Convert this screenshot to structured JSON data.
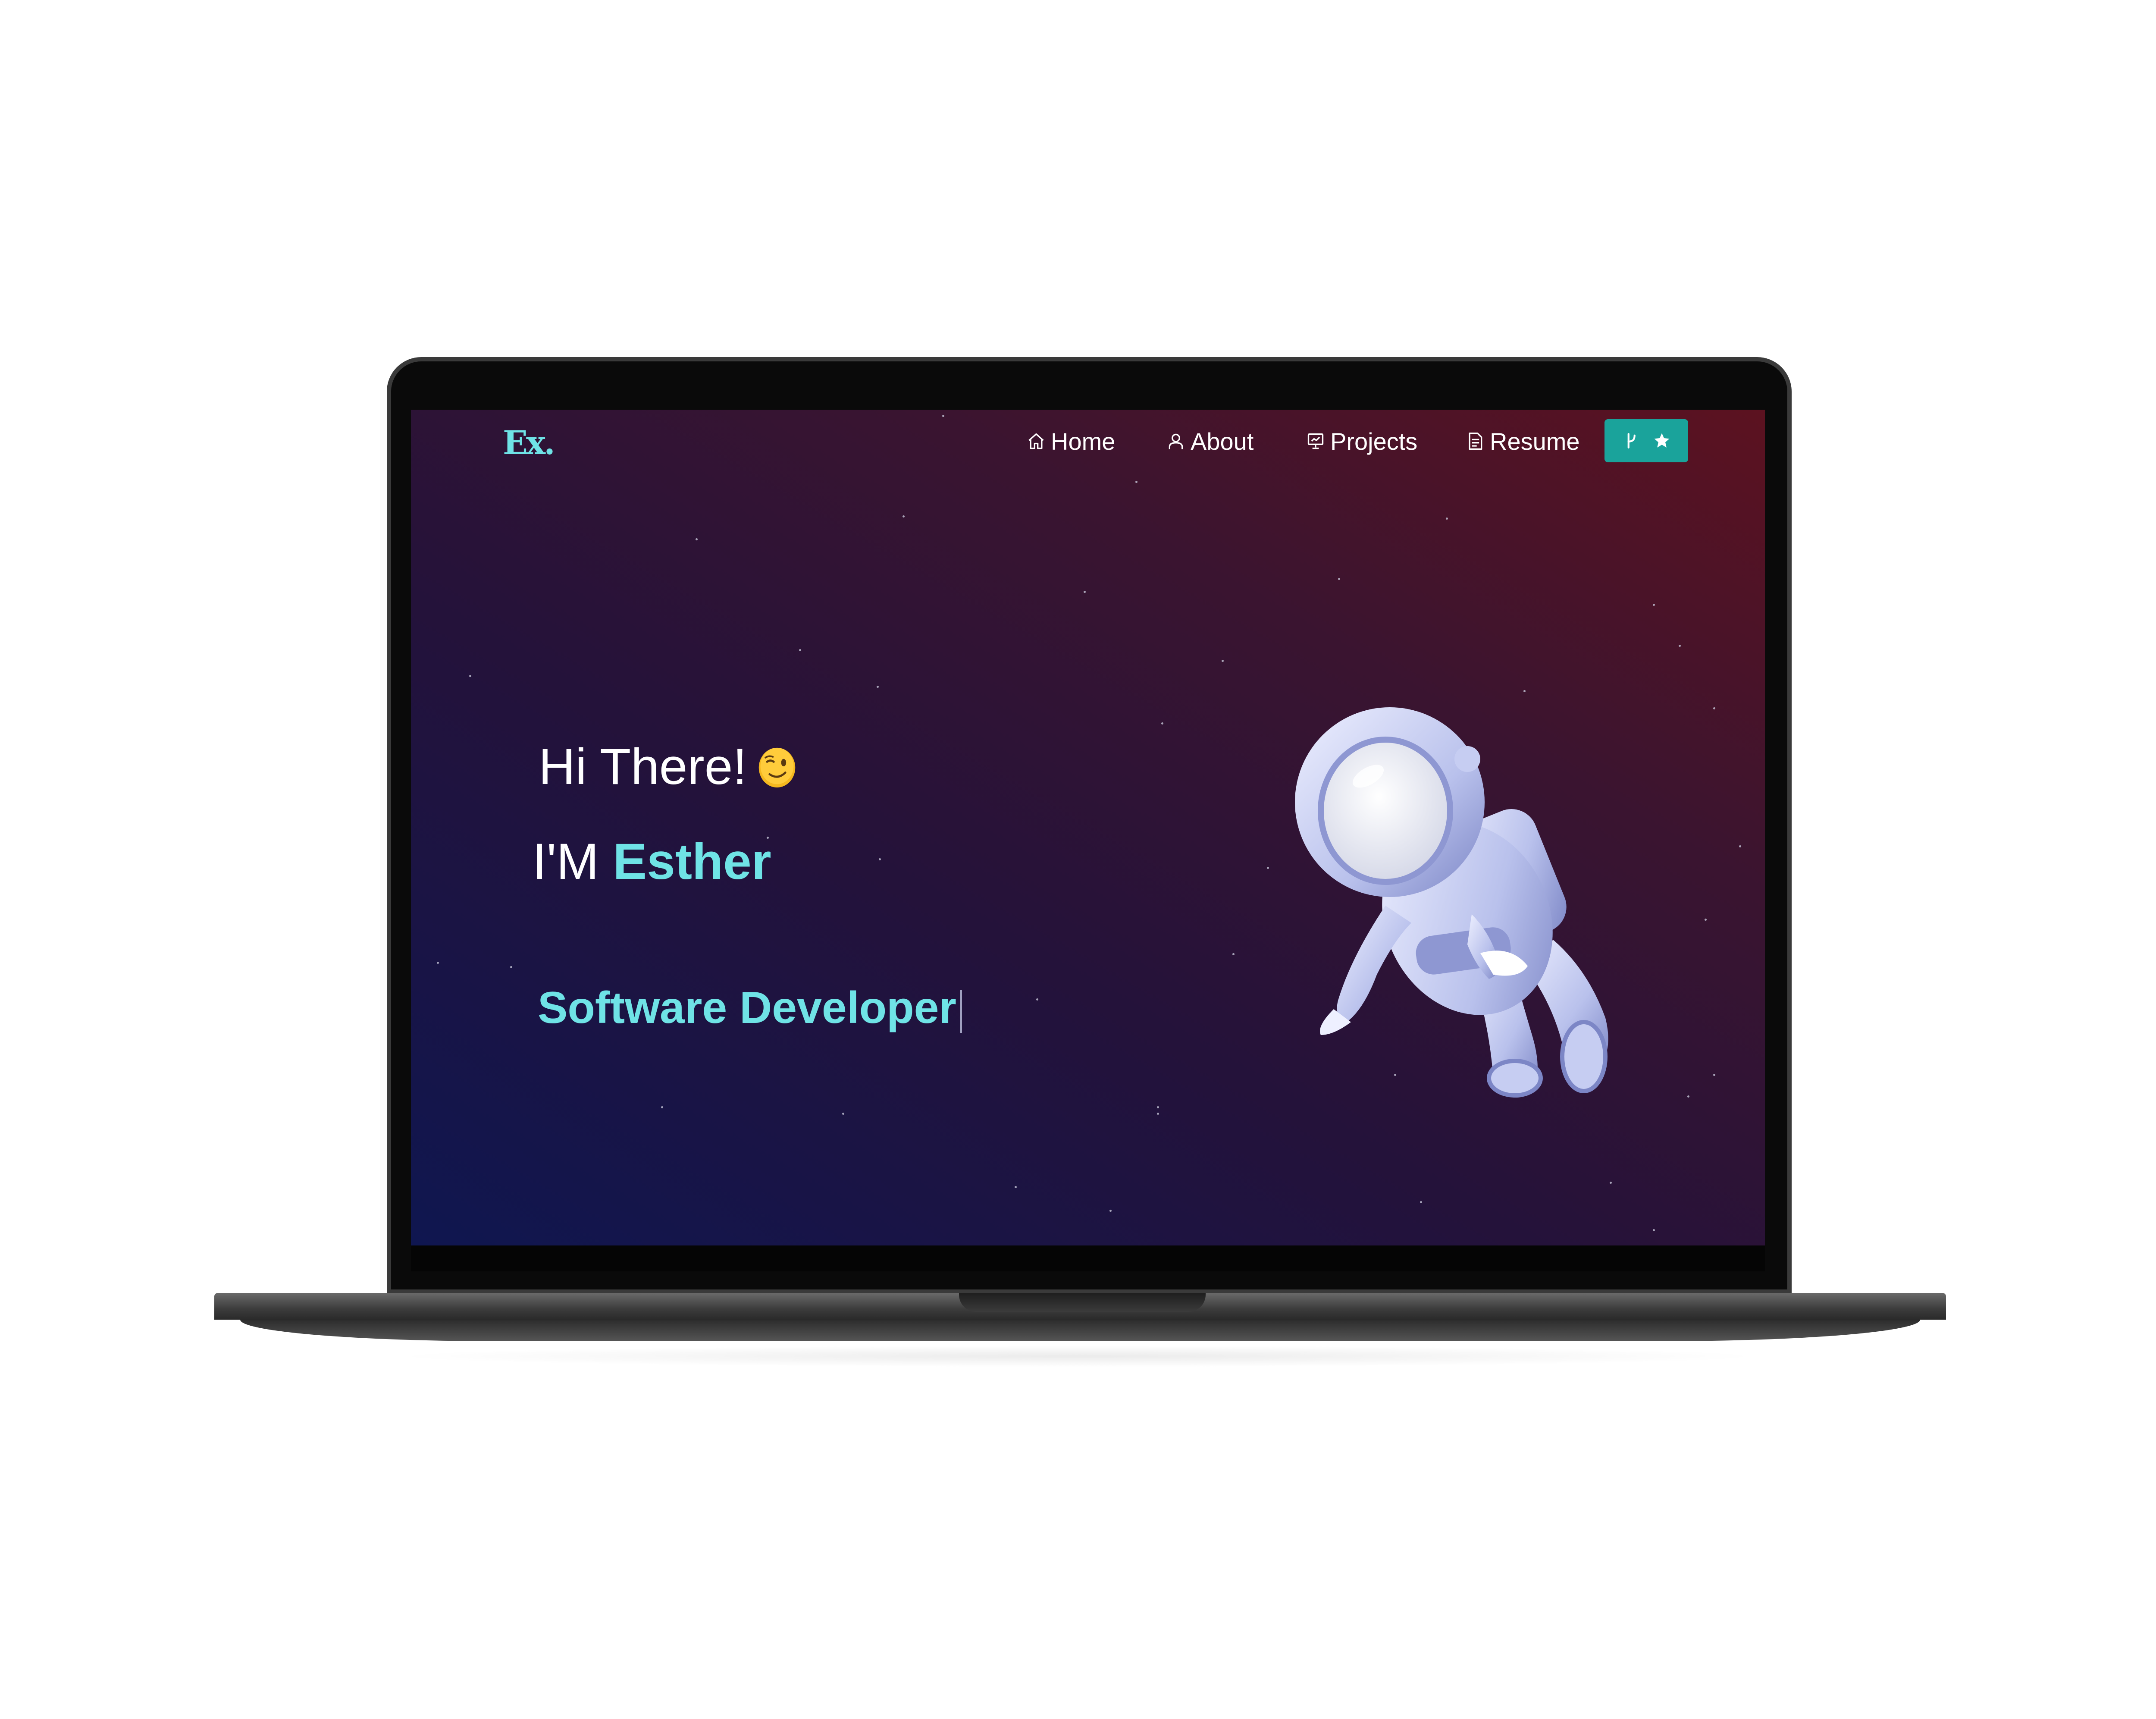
{
  "navbar": {
    "logo": "Ex.",
    "items": [
      {
        "label": "Home",
        "icon": "home-icon"
      },
      {
        "label": "About",
        "icon": "user-icon"
      },
      {
        "label": "Projects",
        "icon": "presentation-icon"
      },
      {
        "label": "Resume",
        "icon": "document-icon"
      }
    ],
    "fork_button": {
      "icons": [
        "git-fork-icon",
        "star-icon"
      ],
      "color": "#1aa39b"
    }
  },
  "hero": {
    "greeting": "Hi There!",
    "greeting_emoji": "winking-face-icon",
    "intro_prefix": "I'M",
    "name": "Esther",
    "role": "Software Developer"
  },
  "colors": {
    "accent": "#6fe3e6",
    "background_top_right": "#5c1220",
    "background_bottom_left": "#0f1650",
    "button": "#1aa39b"
  }
}
